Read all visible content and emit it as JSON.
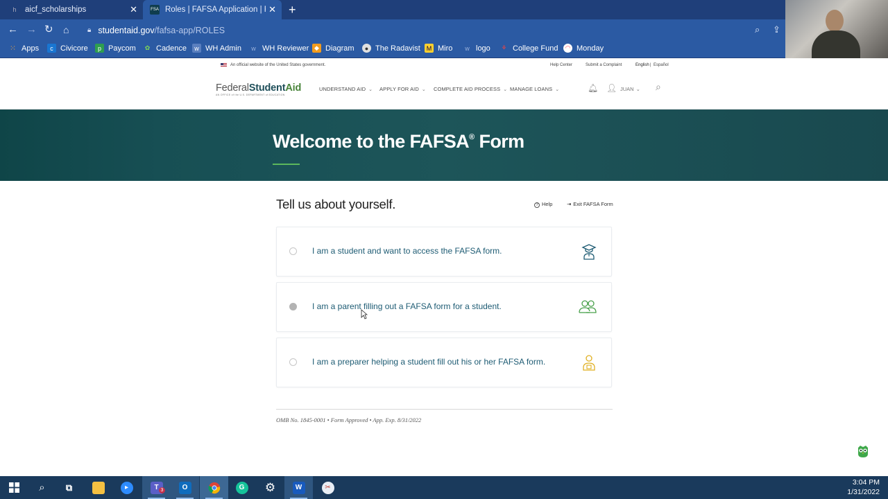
{
  "browser": {
    "tabs": [
      {
        "title": "aicf_scholarships",
        "favicon": "h"
      },
      {
        "title": "Roles | FAFSA Application | Federal Student Aid",
        "favicon": "FSA"
      }
    ],
    "url_host": "studentaid.gov",
    "url_path": "/fafsa-app/ROLES",
    "bookmarks": [
      "Apps",
      "Civicore",
      "Paycom",
      "Cadence",
      "WH Admin",
      "WH Reviewer",
      "Diagram",
      "The Radavist",
      "Miro",
      "logo",
      "College Fund",
      "Monday"
    ]
  },
  "gov_banner": {
    "official": "An official website of the United States government.",
    "help_center": "Help Center",
    "submit_complaint": "Submit a Complaint",
    "english": "English",
    "separator": "|",
    "espanol": "Español"
  },
  "header": {
    "logo_prefix": "Federal",
    "logo_student": "Student",
    "logo_aid": "Aid",
    "logo_tagline": "AN OFFICE of the U.S. DEPARTMENT of EDUCATION",
    "nav": [
      "UNDERSTAND AID",
      "APPLY FOR AID",
      "COMPLETE AID PROCESS",
      "MANAGE LOANS"
    ],
    "user": "JUAN"
  },
  "hero": {
    "title_main": "Welcome to the FAFSA",
    "title_reg": "®",
    "title_end": " Form"
  },
  "form": {
    "title": "Tell us about yourself.",
    "help": "Help",
    "exit": "Exit FAFSA Form",
    "roles": [
      {
        "label": "I am a student and want to access the FAFSA form.",
        "icon": "student-icon"
      },
      {
        "label": "I am a parent filling out a FAFSA form for a student.",
        "icon": "parents-icon"
      },
      {
        "label": "I am a preparer helping a student fill out his or her FAFSA form.",
        "icon": "preparer-icon"
      }
    ],
    "omb": "OMB No. 1845-0001 • Form Approved • App. Exp. 8/31/2022"
  },
  "taskbar": {
    "time": "3:04 PM",
    "date": "1/31/2022",
    "teams_badge": "3"
  },
  "colors": {
    "hero_bg": "#1d5559",
    "accent_green": "#5cb85c",
    "role_text": "#1d5b73",
    "chrome_blue": "#2b5aa3"
  }
}
